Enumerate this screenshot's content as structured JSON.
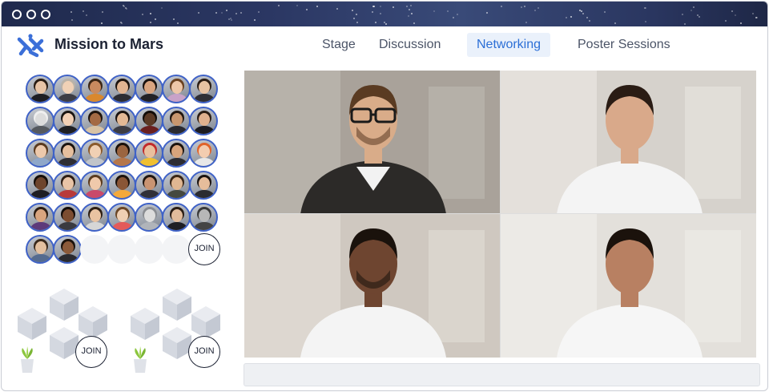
{
  "app": {
    "title": "Mission to Mars"
  },
  "nav": {
    "tabs": [
      {
        "label": "Stage",
        "active": false
      },
      {
        "label": "Discussion",
        "active": false
      },
      {
        "label": "Networking",
        "active": true
      },
      {
        "label": "Poster Sessions",
        "active": false
      }
    ]
  },
  "networking": {
    "main_table": {
      "join_label": "JOIN",
      "participants": [
        {
          "skin": "#e8c4a6",
          "hair": "#2a1d14",
          "shirt": "#1e1e24"
        },
        {
          "skin": "#f0d1b6",
          "hair": "#b9b2a8",
          "shirt": "#3d3d45"
        },
        {
          "skin": "#c98a5f",
          "hair": "#3a2616",
          "shirt": "#d9882e"
        },
        {
          "skin": "#e2b592",
          "hair": "#1d1510",
          "shirt": "#2d2d33"
        },
        {
          "skin": "#d9a580",
          "hair": "#1a1310",
          "shirt": "#222226"
        },
        {
          "skin": "#edc6a8",
          "hair": "#6a4120",
          "shirt": "#c8a2c8"
        },
        {
          "skin": "#e7c2a2",
          "hair": "#2a1d14",
          "shirt": "#2f2f35"
        },
        {
          "skin": "#dcdcdc",
          "hair": "#efefef",
          "shirt": "#55595f"
        },
        {
          "skin": "#f2d0b5",
          "hair": "#1b1612",
          "shirt": "#1f1f22"
        },
        {
          "skin": "#a36a44",
          "hair": "#1e140e",
          "shirt": "#d8c3a5"
        },
        {
          "skin": "#e3b995",
          "hair": "#1a1310",
          "shirt": "#3c3c43"
        },
        {
          "skin": "#5b3a26",
          "hair": "#120c09",
          "shirt": "#6a1f1f"
        },
        {
          "skin": "#c9976f",
          "hair": "#221710",
          "shirt": "#2a2a30"
        },
        {
          "skin": "#e0b18e",
          "hair": "#2b1e15",
          "shirt": "#1c1c22"
        },
        {
          "skin": "#edc9ab",
          "hair": "#5a3a1e",
          "shirt": "#8fa7c9"
        },
        {
          "skin": "#e6bf9e",
          "hair": "#1b1410",
          "shirt": "#2e2e34"
        },
        {
          "skin": "#f0d0b4",
          "hair": "#8a5a2c",
          "shirt": "#c0c4ca"
        },
        {
          "skin": "#9b6540",
          "hair": "#1a110b",
          "shirt": "#b5764a"
        },
        {
          "skin": "#e9c09e",
          "hair": "#c22b2b",
          "shirt": "#f0c030"
        },
        {
          "skin": "#d7a47c",
          "hair": "#1c140f",
          "shirt": "#2c2c32"
        },
        {
          "skin": "#f3cdb0",
          "hair": "#e0632a",
          "shirt": "#e8e8e8"
        },
        {
          "skin": "#6e452d",
          "hair": "#150e0a",
          "shirt": "#1e1e24"
        },
        {
          "skin": "#e8c4a6",
          "hair": "#2d1e14",
          "shirt": "#b83a3a"
        },
        {
          "skin": "#efc9ab",
          "hair": "#5b3b1f",
          "shirt": "#c94a6a"
        },
        {
          "skin": "#8a5636",
          "hair": "#1b120c",
          "shirt": "#f4a93a"
        },
        {
          "skin": "#c99472",
          "hair": "#211711",
          "shirt": "#313138"
        },
        {
          "skin": "#e0b792",
          "hair": "#3a2616",
          "shirt": "#45493f"
        },
        {
          "skin": "#e6bd9b",
          "hair": "#1a1310",
          "shirt": "#2b2b30"
        },
        {
          "skin": "#d9a57f",
          "hair": "#2b1c12",
          "shirt": "#5d3a7a"
        },
        {
          "skin": "#7c4d31",
          "hair": "#120c09",
          "shirt": "#3a3a40"
        },
        {
          "skin": "#e9c3a2",
          "hair": "#2d1f14",
          "shirt": "#d6d6d6"
        },
        {
          "skin": "#efcfb3",
          "hair": "#6b4727",
          "shirt": "#e45a5a"
        },
        {
          "skin": "#dcdcdc",
          "hair": "#8a8d92",
          "shirt": "#b0b4ba"
        },
        {
          "skin": "#e2bc9c",
          "hair": "#2a1d14",
          "shirt": "#1f1f24"
        },
        {
          "skin": "#b7b7b7",
          "hair": "#3a3a3a",
          "shirt": "#444"
        },
        {
          "skin": "#e4c09f",
          "hair": "#3b2a1c",
          "shirt": "#556b8f"
        },
        {
          "skin": "#8b5a3a",
          "hair": "#1b120c",
          "shirt": "#2a2a2f"
        }
      ]
    },
    "small_tables": [
      {
        "join_label": "JOIN"
      },
      {
        "join_label": "JOIN"
      }
    ]
  },
  "video_tiles": [
    {
      "label": "participant-1",
      "bg": "#a9a29a",
      "wall": "#c2bdb6",
      "skin": "#d9ac89",
      "hair": "#5a3b22",
      "shirt": "#2c2a28",
      "inner": "#f2f2f2",
      "glasses": true,
      "beard": true
    },
    {
      "label": "participant-2",
      "bg": "#d6d2cc",
      "wall": "#ece9e4",
      "skin": "#d9a98a",
      "hair": "#2a1c14",
      "shirt": "#f4f4f4",
      "inner": "#f4f4f4",
      "glasses": false,
      "beard": false
    },
    {
      "label": "participant-3",
      "bg": "#cfc8c0",
      "wall": "#e6e1da",
      "skin": "#6e4530",
      "hair": "#1a120c",
      "shirt": "#f4f4f4",
      "inner": "#f4f4f4",
      "glasses": false,
      "beard": true
    },
    {
      "label": "participant-4",
      "bg": "#e3e0db",
      "wall": "#f2f0ec",
      "skin": "#b88062",
      "hair": "#1b120c",
      "shirt": "#f6f6f6",
      "inner": "#f6f6f6",
      "glasses": false,
      "beard": false
    }
  ],
  "colors": {
    "accent": "#2c6fd6",
    "avatar_border": "#3f62c7",
    "brand_text": "#1c2233"
  },
  "icons": {
    "logo": "mission-logo-icon",
    "window_controls": [
      "window-dot-icon",
      "window-dot-icon",
      "window-dot-icon"
    ]
  }
}
